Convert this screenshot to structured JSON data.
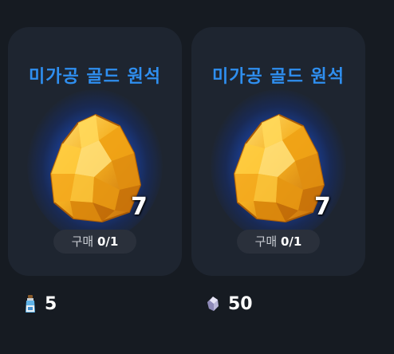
{
  "shop": {
    "items": [
      {
        "title": "미가공 골드 원석",
        "quantity": "7",
        "purchase_label": "구매",
        "purchase_count": "0/1",
        "item_icon": "gold-ore-icon",
        "price_currency_icon": "potion-bottle-icon",
        "price_value": "5"
      },
      {
        "title": "미가공 골드 원석",
        "quantity": "7",
        "purchase_label": "구매",
        "purchase_count": "0/1",
        "item_icon": "gold-ore-icon",
        "price_currency_icon": "crystal-shard-icon",
        "price_value": "50"
      }
    ]
  },
  "colors": {
    "background": "#161b22",
    "card": "#1e2530",
    "title": "#2f8ff0",
    "glow": "#2a6ef5",
    "gold": "#f2a51c"
  }
}
